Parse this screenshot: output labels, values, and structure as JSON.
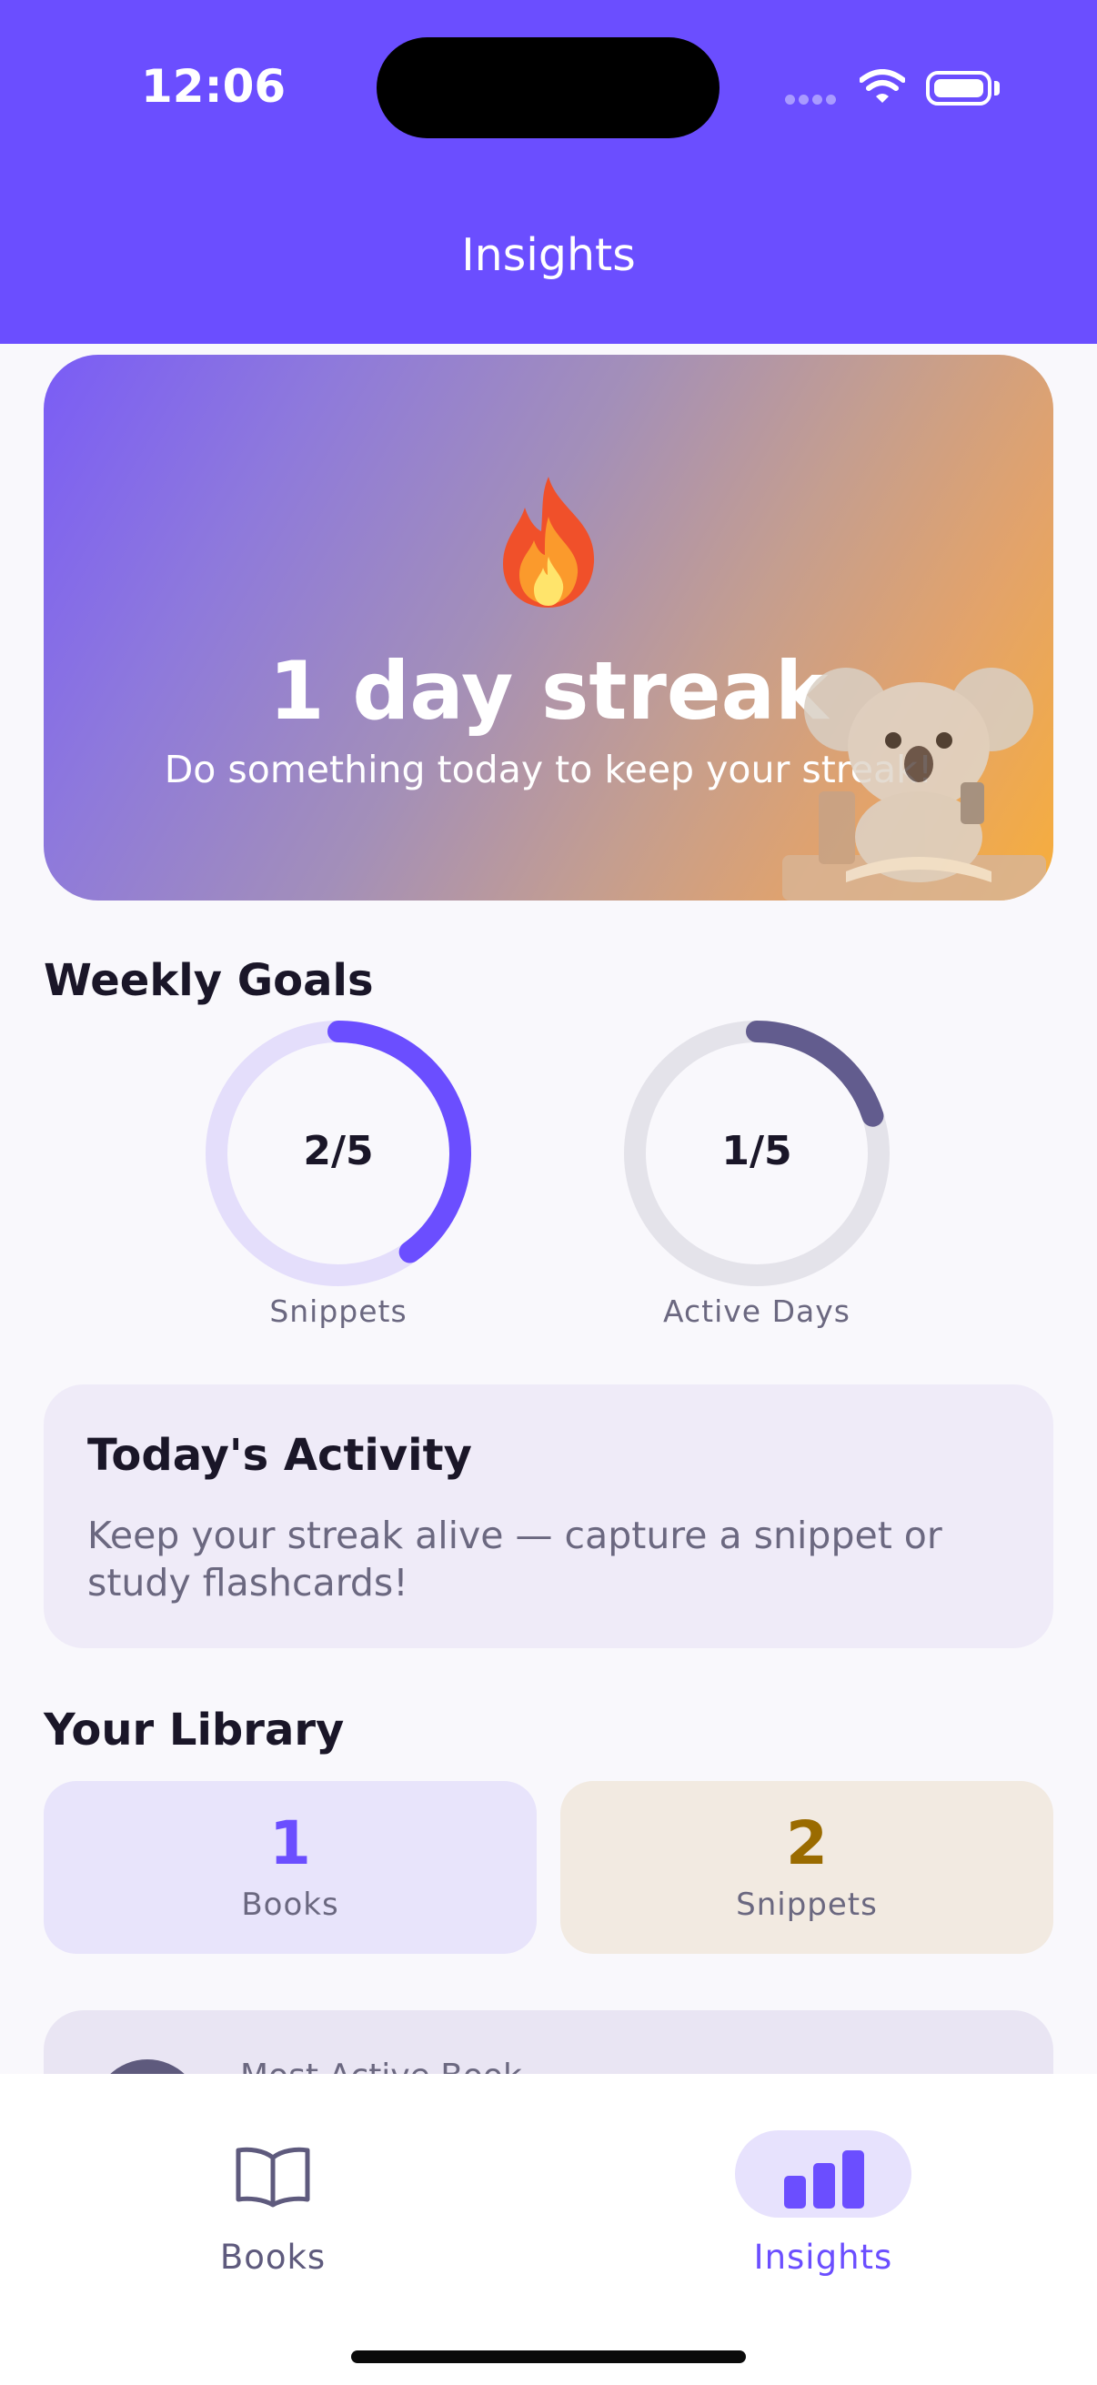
{
  "status_bar": {
    "time": "12:06"
  },
  "header": {
    "title": "Insights"
  },
  "streak": {
    "emoji": "🔥",
    "title": "1 day streak",
    "subtitle": "Do something today to keep your streak!"
  },
  "weekly_goals": {
    "title": "Weekly Goals",
    "goals": [
      {
        "value_text": "2/5",
        "label": "Snippets",
        "progress": 0.4,
        "color": "#6B4EFF",
        "track": "#E4DEFB"
      },
      {
        "value_text": "1/5",
        "label": "Active Days",
        "progress": 0.2,
        "color": "#625C8E",
        "track": "#E4E3EA"
      }
    ]
  },
  "activity": {
    "title": "Today's Activity",
    "text": "Keep your streak alive — capture a snippet or study flashcards!"
  },
  "library": {
    "title": "Your Library",
    "books": {
      "count": "1",
      "label": "Books",
      "color": "#6B4EFF",
      "bg": "#E8E4FB"
    },
    "snippets": {
      "count": "2",
      "label": "Snippets",
      "color": "#9A6B00",
      "bg": "#F2EAE1"
    },
    "most_active_label": "Most Active Book"
  },
  "tabbar": {
    "books_label": "Books",
    "insights_label": "Insights",
    "active_color": "#6B4EFF",
    "inactive_color": "#5E5A7D"
  }
}
